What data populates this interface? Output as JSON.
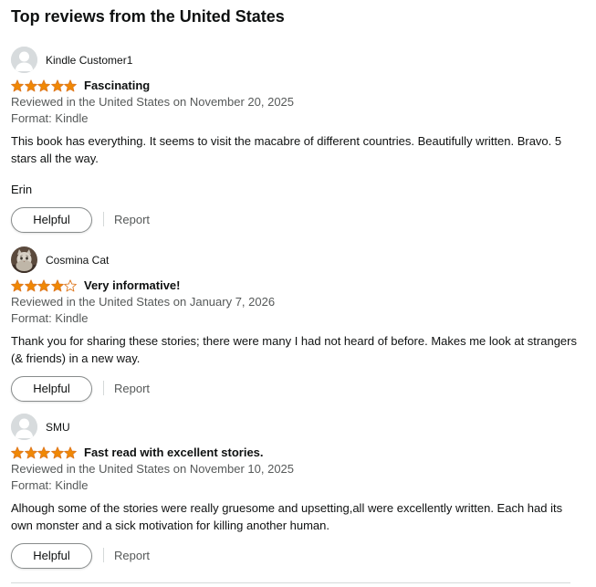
{
  "section": {
    "title": "Top reviews from the United States"
  },
  "colors": {
    "star_fill": "#f08804",
    "star_stroke": "#de7921",
    "meta_text": "#565959",
    "avatar_bg": "#d7dbdd"
  },
  "reviews": [
    {
      "author": "Kindle Customer1",
      "avatar": "default-avatar-icon",
      "rating": 5,
      "rating_max": 5,
      "title": "Fascinating",
      "date_line": "Reviewed in the United States on November 20, 2025",
      "format_line": "Format: Kindle",
      "body": "This book has everything. It seems to visit the macabre of different countries. Beautifully written. Bravo. 5 stars all the way.",
      "signature": "Erin",
      "helpful_label": "Helpful",
      "report_label": "Report"
    },
    {
      "author": "Cosmina Cat",
      "avatar": "cat-avatar-icon",
      "rating": 4,
      "rating_max": 5,
      "title": "Very informative!",
      "date_line": "Reviewed in the United States on January 7, 2026",
      "format_line": "Format: Kindle",
      "body": "Thank you for sharing these stories; there were many I had not heard of before. Makes me look at strangers (& friends) in a new way.",
      "helpful_label": "Helpful",
      "report_label": "Report"
    },
    {
      "author": "SMU",
      "avatar": "default-avatar-icon",
      "rating": 5,
      "rating_max": 5,
      "title": "Fast read with excellent stories.",
      "date_line": "Reviewed in the United States on November 10, 2025",
      "format_line": "Format: Kindle",
      "body": "Alhough some of the stories were really gruesome and upsetting,all were excellently written. Each had its own monster and a sick motivation for killing another human.",
      "helpful_label": "Helpful",
      "report_label": "Report"
    }
  ]
}
